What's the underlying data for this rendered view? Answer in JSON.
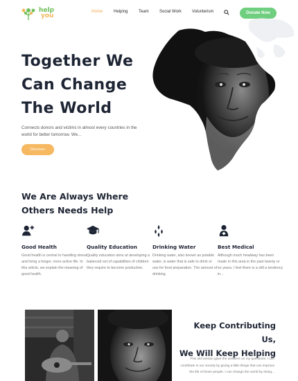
{
  "brand": {
    "line1": "help",
    "line2": "you"
  },
  "nav": {
    "items": [
      "Home",
      "Helping",
      "Team",
      "Social Work",
      "Volunterism"
    ],
    "active": "Home",
    "donate_label": "Donate Now"
  },
  "hero": {
    "title_line1_highlight": "Together",
    "title_line1_rest": " We",
    "title_line2": "Can Change",
    "title_line3": "The World",
    "description": "Connects donors and victims in almost every countries in the world for better tomorrow. We...",
    "button_label": "Discover"
  },
  "section_help": {
    "title_line1": "We Are Always Where",
    "title_line2_pre": "Others ",
    "title_line2_highlight": "Needs",
    "title_line2_post": " Help",
    "features": [
      {
        "icon": "add-user-icon",
        "title": "Good Health",
        "description": "Good health is central to handling stress and living a longer, more active life. In this article, we explain the meaning of good health."
      },
      {
        "icon": "graduation-cap-icon",
        "title": "Quality Education",
        "description": "Quality education aims at developing a balanced set of capabilities of children they require to become productive."
      },
      {
        "icon": "water-drops-icon",
        "title": "Drinking Water",
        "description": "Drinking water, also known as potable water, is water that is safe to drink or use for food preparation. The amount of drinking."
      },
      {
        "icon": "medical-person-icon",
        "title": "Best Medical",
        "description": "Although much headway has been made in this area in the past twenty or so years, I feel there is a still a tendency in..."
      }
    ]
  },
  "section_keep": {
    "title_line1": "Keep Contributing Us,",
    "title_line2_pre": "We Will ",
    "title_line2_highlight": "Keep Helping",
    "description": "This old woman gave the answers on my questions. I can contribute in our society by giving a little things that can improve the life of those people, I can change the world by doing..."
  },
  "colors": {
    "accent_orange": "#f6b860",
    "accent_green": "#6fcf7f",
    "heading": "#1d2433"
  }
}
